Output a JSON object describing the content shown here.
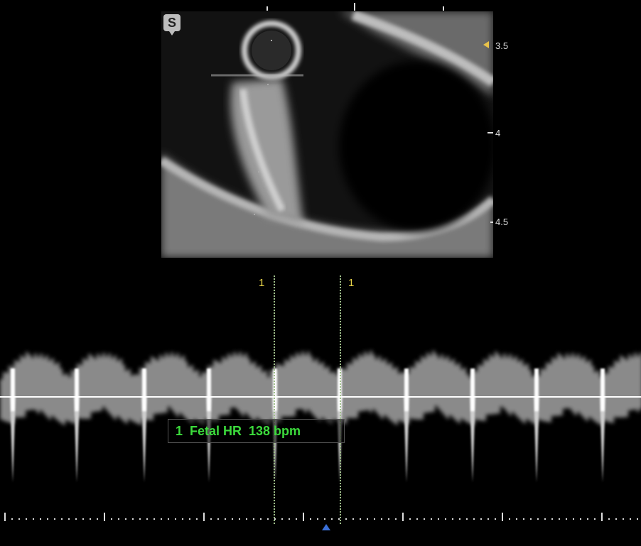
{
  "image": {
    "s_badge": "S",
    "depth_labels": [
      "3.5",
      "4",
      "4.5"
    ],
    "cursor_labels": [
      "1",
      "1"
    ],
    "measurement": "1  Fetal HR  138 bpm",
    "colors": {
      "background": "#000000",
      "measurement_text": "#3cdb3c",
      "cursor_label": "#e8d44a",
      "focus_marker": "#e8c24a",
      "time_marker": "#3a6fd8"
    }
  }
}
